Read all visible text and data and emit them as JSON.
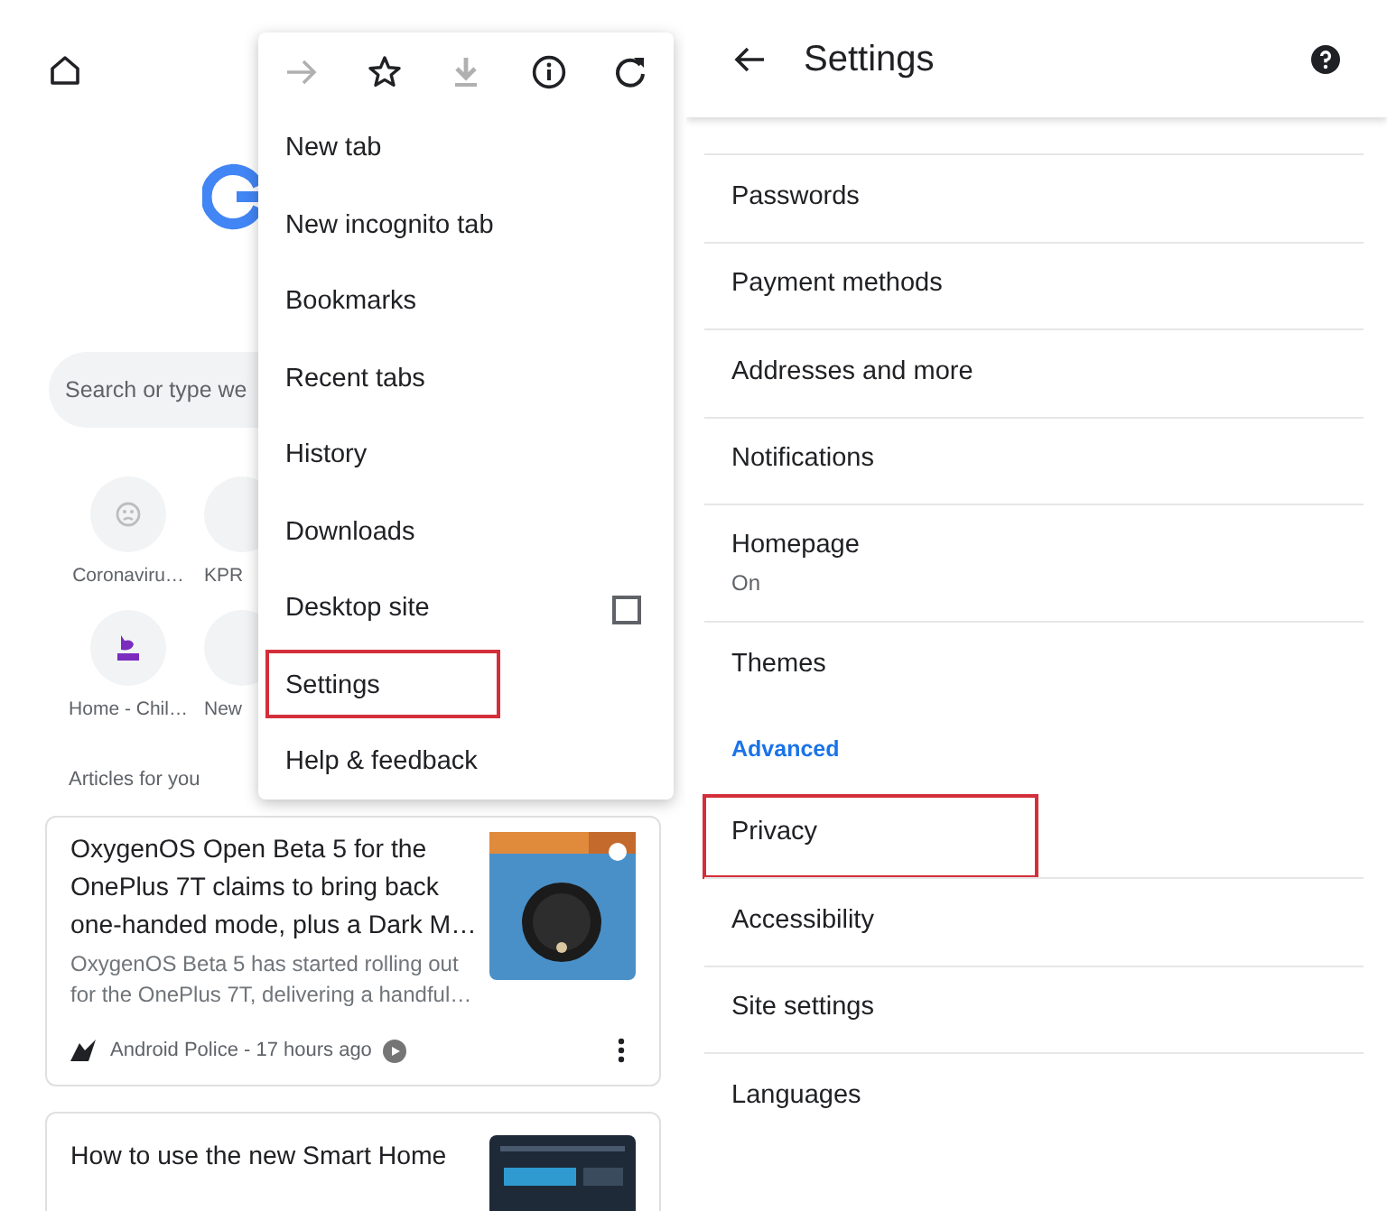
{
  "new_tab_page": {
    "search": {
      "placeholder": "Search or type we"
    },
    "shortcuts": [
      {
        "label": "Coronaviru…",
        "kind": "generic"
      },
      {
        "label": "KPR",
        "kind": "hidden"
      },
      {
        "label": "Home - Chil…",
        "kind": "brand"
      },
      {
        "label": "New",
        "kind": "hidden"
      }
    ],
    "articles_heading": "Articles for you",
    "articles": [
      {
        "title": "OxygenOS Open Beta 5 for the OnePlus 7T claims to bring back one-handed mode, plus a Dark M…",
        "snippet": "OxygenOS Beta 5 has started rolling out for the OnePlus 7T, delivering a handful…",
        "source": "Android Police - 17 hours ago"
      },
      {
        "title": "How to use the new Smart Home"
      }
    ]
  },
  "menu": {
    "icons": [
      {
        "kind": "forward",
        "disabled": true
      },
      {
        "kind": "star",
        "disabled": false
      },
      {
        "kind": "download",
        "disabled": true
      },
      {
        "kind": "info",
        "disabled": false
      },
      {
        "kind": "refresh",
        "disabled": false
      }
    ],
    "items": [
      {
        "label": "New tab",
        "kind": "plain",
        "highlighted": false
      },
      {
        "label": "New incognito tab",
        "kind": "plain",
        "highlighted": false
      },
      {
        "label": "Bookmarks",
        "kind": "plain",
        "highlighted": false
      },
      {
        "label": "Recent tabs",
        "kind": "plain",
        "highlighted": false
      },
      {
        "label": "History",
        "kind": "plain",
        "highlighted": false
      },
      {
        "label": "Downloads",
        "kind": "plain",
        "highlighted": false
      },
      {
        "label": "Desktop site",
        "kind": "checkbox",
        "checked": false,
        "highlighted": false
      },
      {
        "label": "Settings",
        "kind": "plain",
        "highlighted": true
      },
      {
        "label": "Help & feedback",
        "kind": "plain",
        "highlighted": false
      }
    ]
  },
  "settings": {
    "title": "Settings",
    "items": [
      {
        "kind": "item",
        "label": "Passwords",
        "highlighted": false
      },
      {
        "kind": "item",
        "label": "Payment methods",
        "highlighted": false
      },
      {
        "kind": "item",
        "label": "Addresses and more",
        "highlighted": false
      },
      {
        "kind": "item",
        "label": "Notifications",
        "highlighted": false
      },
      {
        "kind": "item",
        "label": "Homepage",
        "sublabel": "On",
        "highlighted": false
      },
      {
        "kind": "item",
        "label": "Themes",
        "highlighted": false
      },
      {
        "kind": "section",
        "label": "Advanced"
      },
      {
        "kind": "item",
        "label": "Privacy",
        "highlighted": true
      },
      {
        "kind": "item",
        "label": "Accessibility",
        "highlighted": false
      },
      {
        "kind": "item",
        "label": "Site settings",
        "highlighted": false
      },
      {
        "kind": "item",
        "label": "Languages",
        "highlighted": false
      }
    ]
  }
}
